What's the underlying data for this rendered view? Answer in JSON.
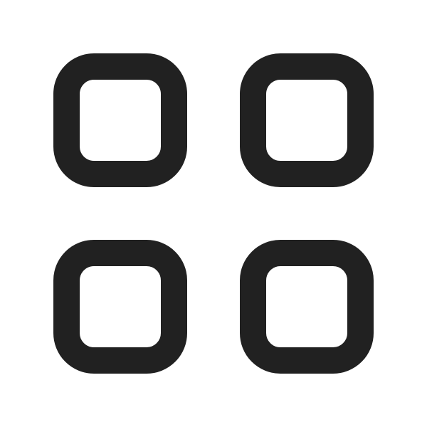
{
  "icon": {
    "name": "apps-grid-icon",
    "stroke_color": "#212121",
    "background_color": "#ffffff",
    "tiles": [
      {
        "id": "top-left"
      },
      {
        "id": "top-right"
      },
      {
        "id": "bottom-left"
      },
      {
        "id": "bottom-right"
      }
    ]
  }
}
